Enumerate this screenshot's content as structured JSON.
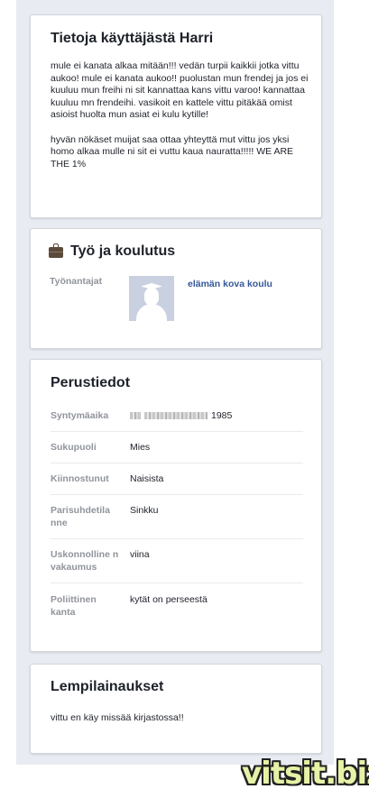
{
  "about": {
    "title": "Tietoja käyttäjästä Harri",
    "paragraph1": "mule ei kanata alkaa mitään!!! vedän turpii kaikkii jotka vittu aukoo! mule ei kanata aukoo!! puolustan mun frendej ja jos ei kuuluu mun freihi ni sit kannattaa kans vittu varoo! kannattaa kuuluu mn frendeihi. vasikoit en kattele vittu pitäkää omist asioist huolta mun asiat ei kulu kytille!",
    "paragraph2": "hyvän nökäset muijat saa ottaa yhteyttä mut vittu jos yksi homo alkaa mulle ni sit ei vuttu kaua nauratta!!!!! WE ARE THE 1%"
  },
  "work": {
    "title": "Työ ja koulutus",
    "icon": "briefcase-icon",
    "employers_label": "Työnantajat",
    "employer_name": "elämän kova koulu"
  },
  "basic": {
    "title": "Perustiedot",
    "rows": [
      {
        "key": "Syntymäaika",
        "value": "1985"
      },
      {
        "key": "Sukupuoli",
        "value": "Mies"
      },
      {
        "key": "Kiinnostunut",
        "value": "Naisista"
      },
      {
        "key": "Parisuhdetila nne",
        "value": "Sinkku"
      },
      {
        "key": "Uskonnolline n vakaumus",
        "value": "viina"
      },
      {
        "key": "Poliittinen kanta",
        "value": "kytät on perseestä"
      }
    ]
  },
  "quotes": {
    "title": "Lempilainaukset",
    "text": "vittu en käy missää kirjastossa!!"
  },
  "watermark": "vitsit.biz",
  "colors": {
    "column_bg": "#e9ebf3",
    "link": "#365899",
    "label": "#90949c",
    "watermark_fill": "#e7f2a6"
  }
}
